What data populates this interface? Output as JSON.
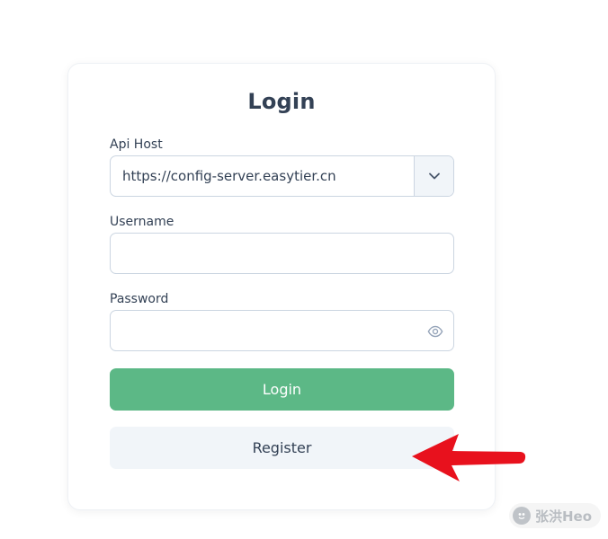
{
  "login_form": {
    "title": "Login",
    "api_host": {
      "label": "Api Host",
      "value": "https://config-server.easytier.cn"
    },
    "username": {
      "label": "Username",
      "value": ""
    },
    "password": {
      "label": "Password",
      "value": ""
    },
    "login_button": "Login",
    "register_button": "Register"
  },
  "watermark": {
    "text": "张洪Heo"
  },
  "colors": {
    "primary": "#5cb886",
    "secondary_bg": "#f1f5f9",
    "text": "#334155",
    "border": "#cbd5e1",
    "annotation": "#e8111d"
  }
}
